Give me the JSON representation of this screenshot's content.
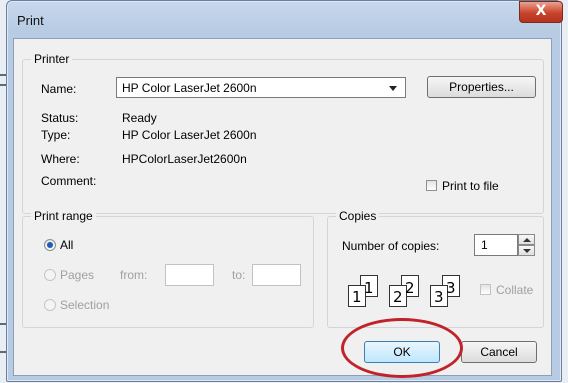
{
  "dialog": {
    "title": "Print",
    "close_glyph": "X"
  },
  "printer": {
    "group_label": "Printer",
    "name_label": "Name:",
    "name_value": "HP Color LaserJet 2600n",
    "properties_label": "Properties...",
    "status_label": "Status:",
    "status_value": "Ready",
    "type_label": "Type:",
    "type_value": "HP Color LaserJet 2600n",
    "where_label": "Where:",
    "where_value": "HPColorLaserJet2600n",
    "comment_label": "Comment:",
    "print_to_file_label": "Print to file",
    "print_to_file_checked": false
  },
  "print_range": {
    "group_label": "Print range",
    "all_label": "All",
    "pages_label": "Pages",
    "from_label": "from:",
    "to_label": "to:",
    "selection_label": "Selection",
    "selected": "All"
  },
  "copies": {
    "group_label": "Copies",
    "number_label": "Number of copies:",
    "number_value": "1",
    "collate_label": "Collate",
    "collate_checked": false,
    "page_icons": [
      {
        "back": "1",
        "front": "1"
      },
      {
        "back": "2",
        "front": "2"
      },
      {
        "back": "3",
        "front": "3"
      }
    ]
  },
  "buttons": {
    "ok_label": "OK",
    "cancel_label": "Cancel"
  },
  "colors": {
    "title_bar": "#b7cbe3",
    "close_button": "#c8432c",
    "highlight_ring": "#c0242a",
    "ok_button_border": "#3c7fb1"
  }
}
